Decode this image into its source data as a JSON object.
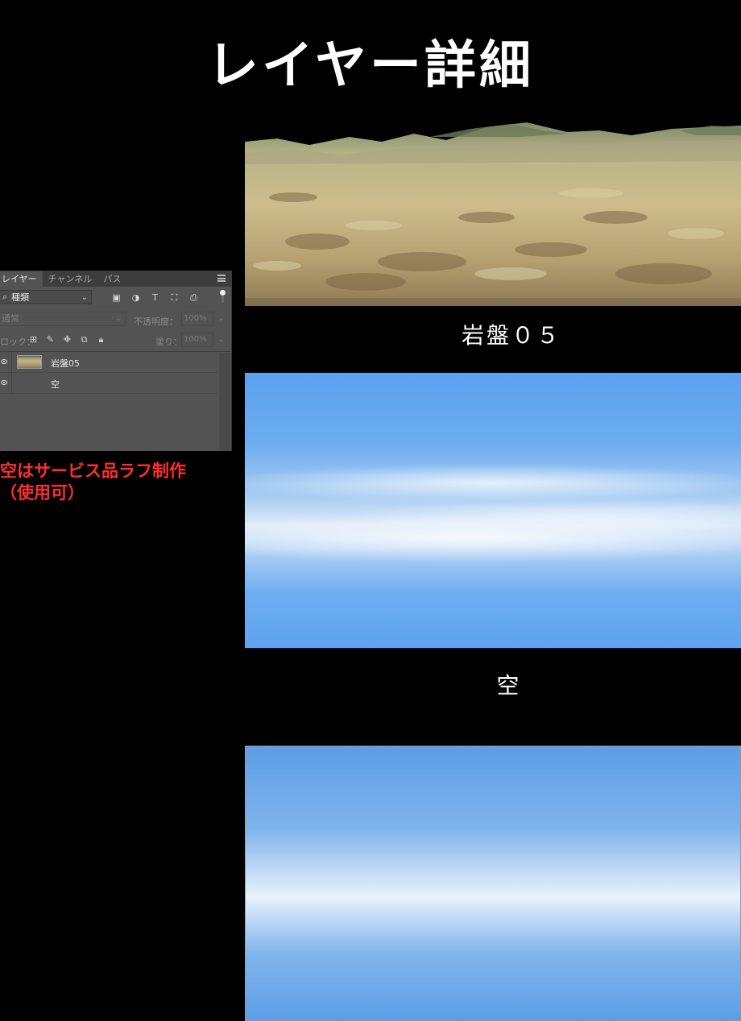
{
  "title": "レイヤー詳細",
  "layers_panel": {
    "tabs": [
      "レイヤー",
      "チャンネル",
      "パス"
    ],
    "kind_filter": {
      "label": "種類"
    },
    "blend_mode": "通常",
    "opacity_label": "不透明度：",
    "opacity_value": "100%",
    "lock_label": "ロック：",
    "fill_label": "塗り：",
    "fill_value": "100%",
    "filter_icons": [
      "image-filter-icon",
      "adjustment-filter-icon",
      "type-filter-icon",
      "shape-filter-icon",
      "smart-object-filter-icon"
    ],
    "lock_icons": [
      "lock-transparent-icon",
      "lock-image-icon",
      "lock-position-icon",
      "lock-artboard-icon",
      "lock-all-icon"
    ],
    "layers": [
      {
        "name": "岩盤05",
        "visible": true,
        "thumbnail": "rock"
      },
      {
        "name": "空",
        "visible": true,
        "thumbnail": "sky"
      }
    ]
  },
  "note": {
    "line1": "空はサービス品ラフ制作",
    "line2": "（使用可）",
    "color": "#ff2f2f"
  },
  "captions": {
    "rock": "岩盤０５",
    "sky": "空"
  },
  "colors": {
    "background": "#000000",
    "panel": "#535353",
    "sky_top": "#5ba1ef"
  }
}
